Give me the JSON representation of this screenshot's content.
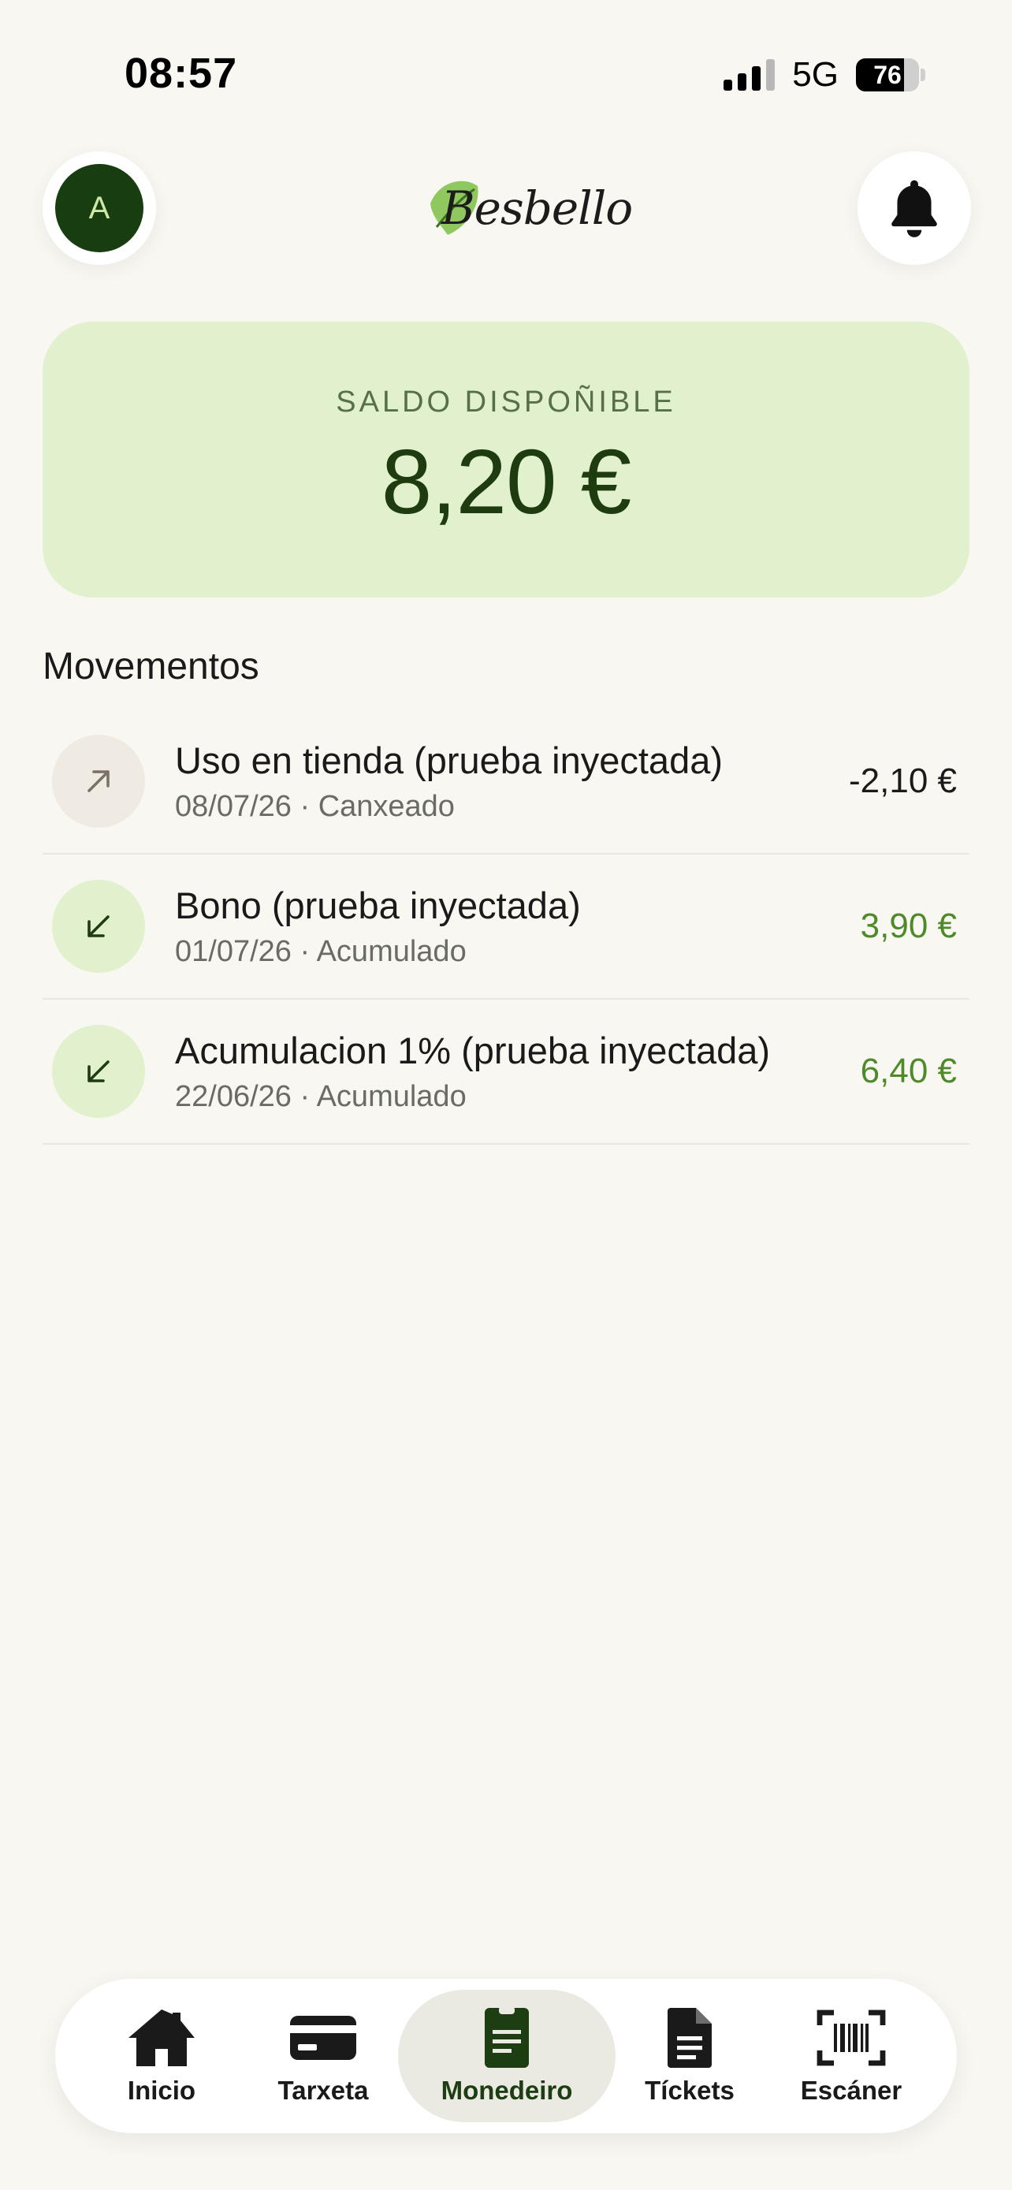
{
  "status_bar": {
    "time": "08:57",
    "network": "5G",
    "battery": "76"
  },
  "header": {
    "avatar_initial": "A",
    "logo_text": "Besbello",
    "bell_icon": "bell-icon"
  },
  "balance": {
    "label": "SALDO DISPOÑIBLE",
    "amount": "8,20 €"
  },
  "movements": {
    "title": "Movementos",
    "items": [
      {
        "title": "Uso en tienda (prueba inyectada)",
        "subtitle": "08/07/26 · Canxeado",
        "amount": "-2,10 €",
        "direction": "out",
        "icon": "arrow-up-right-icon"
      },
      {
        "title": "Bono (prueba inyectada)",
        "subtitle": "01/07/26 · Acumulado",
        "amount": "3,90 €",
        "direction": "in",
        "icon": "arrow-down-left-icon"
      },
      {
        "title": "Acumulacion 1% (prueba inyectada)",
        "subtitle": "22/06/26 · Acumulado",
        "amount": "6,40 €",
        "direction": "in",
        "icon": "arrow-down-left-icon"
      }
    ]
  },
  "nav": {
    "tabs": [
      {
        "label": "Inicio",
        "icon": "home-icon"
      },
      {
        "label": "Tarxeta",
        "icon": "card-icon"
      },
      {
        "label": "Monedeiro",
        "icon": "wallet-icon",
        "active": true
      },
      {
        "label": "Tíckets",
        "icon": "document-icon"
      },
      {
        "label": "Escáner",
        "icon": "barcode-scan-icon"
      }
    ]
  },
  "colors": {
    "background": "#f8f7f1",
    "card": "#e1f0cd",
    "accent_dark": "#173d10",
    "positive": "#4f8a2a"
  }
}
